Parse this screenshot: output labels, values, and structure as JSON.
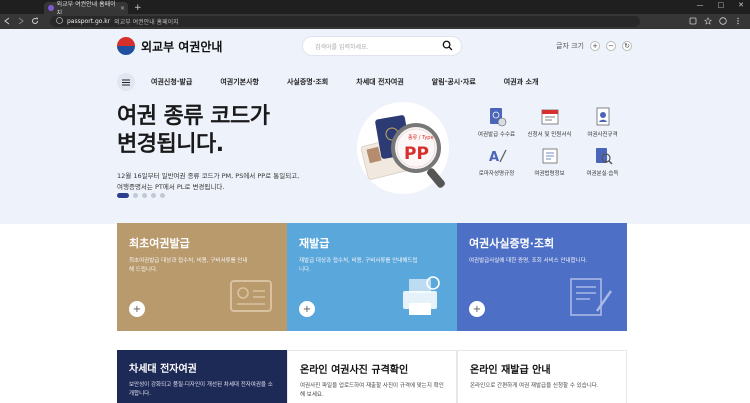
{
  "browser": {
    "tab_title": "외교부 여권안내 홈페이지",
    "tab_close": "×",
    "new_tab": "+",
    "url_domain": "passport.go.kr",
    "url_title": "외교부 여권안내 홈페이지",
    "win_min": "—",
    "win_max": "□",
    "win_close": "✕"
  },
  "header": {
    "logo_text": "외교부 여권안내",
    "search_placeholder": "검색어를 입력하세요.",
    "font_size_label": "글자 크기",
    "plus": "+",
    "minus": "−",
    "reset": "↻"
  },
  "menu": {
    "items": [
      "여권신청·발급",
      "여권기본사항",
      "사실증명·조회",
      "차세대 전자여권",
      "알림·공시·자료",
      "여권과 소개"
    ]
  },
  "hero": {
    "headline_line1": "여권 종류 코드가",
    "headline_line2": "변경됩니다.",
    "desc_line1": "12월 16일부터 일반여권 종류 코드가 PM, PS에서 PP로 통일되고,",
    "desc_line2": "여행증명서는 PT에서 PL로 변경됩니다.",
    "badge_text": "PP",
    "badge_sub": "종류 / Type"
  },
  "quick_links": [
    {
      "label": "여권발급 수수료",
      "icon": "passport-fee-icon"
    },
    {
      "label": "신청서 및 민원서식",
      "icon": "form-icon"
    },
    {
      "label": "여권사진규격",
      "icon": "photo-spec-icon"
    },
    {
      "label": "로마자성명규정",
      "icon": "romanization-icon"
    },
    {
      "label": "여권법령정보",
      "icon": "law-icon"
    },
    {
      "label": "여권분실·습득",
      "icon": "lost-passport-icon"
    }
  ],
  "cards": [
    {
      "title": "최초여권발급",
      "desc": "최초여권발급 대상과 접수처, 비용, 구비서류를 안내해 드립니다.",
      "color": "#b99a6c"
    },
    {
      "title": "재발급",
      "desc": "재발급 대상과 접수처, 비용, 구비서류를 안내해드립니다.",
      "color": "#5aa7dc"
    },
    {
      "title": "여권사실증명·조회",
      "desc": "여권발급사실에 대한 증명, 조회 서비스 안내합니다.",
      "color": "#4d6fc6"
    }
  ],
  "cards2": [
    {
      "title": "차세대 전자여권",
      "desc": "보안성이 강화되고 품질·디자인이 개선된 차세대 전자여권을 소개합니다."
    },
    {
      "title": "온라인 여권사진 규격확인",
      "desc": "여권사진 파일을 업로드하여 재출할 사진이 규격에 맞는지 확인해 보세요."
    },
    {
      "title": "온라인 재발급 안내",
      "desc": "온라인으로 간편하게 여권 재발급을 신청할 수 있습니다."
    }
  ],
  "colors": {
    "navy": "#1e2a56",
    "hero_bg": "#eef2fa",
    "accent_red": "#d6302c"
  }
}
